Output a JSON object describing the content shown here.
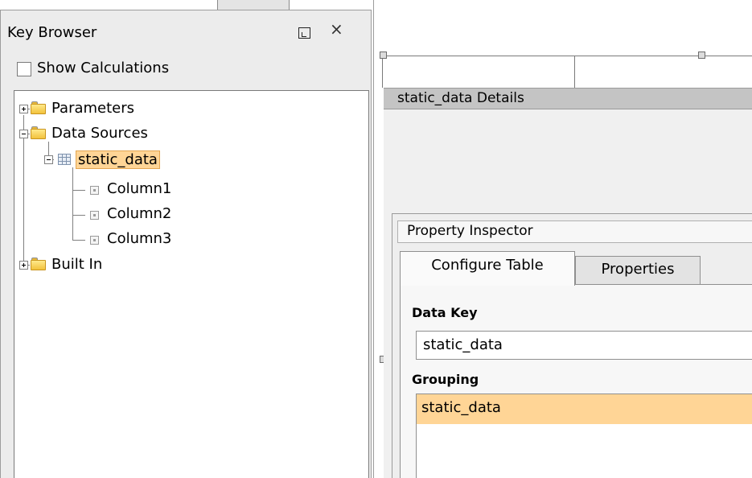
{
  "key_browser": {
    "title": "Key Browser",
    "show_calculations_label": "Show Calculations",
    "show_calculations_checked": false,
    "tree": {
      "parameters": "Parameters",
      "data_sources": "Data Sources",
      "static_data": "static_data",
      "columns": [
        "Column1",
        "Column2",
        "Column3"
      ],
      "built_in": "Built In"
    }
  },
  "details": {
    "title": "static_data Details"
  },
  "property_inspector": {
    "title": "Property Inspector",
    "tabs": [
      {
        "label": "Configure Table",
        "active": true
      },
      {
        "label": "Properties",
        "active": false
      }
    ],
    "data_key_label": "Data Key",
    "data_key_value": "static_data",
    "grouping_label": "Grouping",
    "grouping_items": [
      "static_data"
    ]
  },
  "icons": {
    "restore": "restore-window-icon",
    "close": "close-icon",
    "folder": "folder-icon",
    "table": "table-icon",
    "column": "column-icon"
  },
  "colors": {
    "selection": "#ffd596",
    "folder": "#f2c23c",
    "header": "#c4c4c4"
  }
}
